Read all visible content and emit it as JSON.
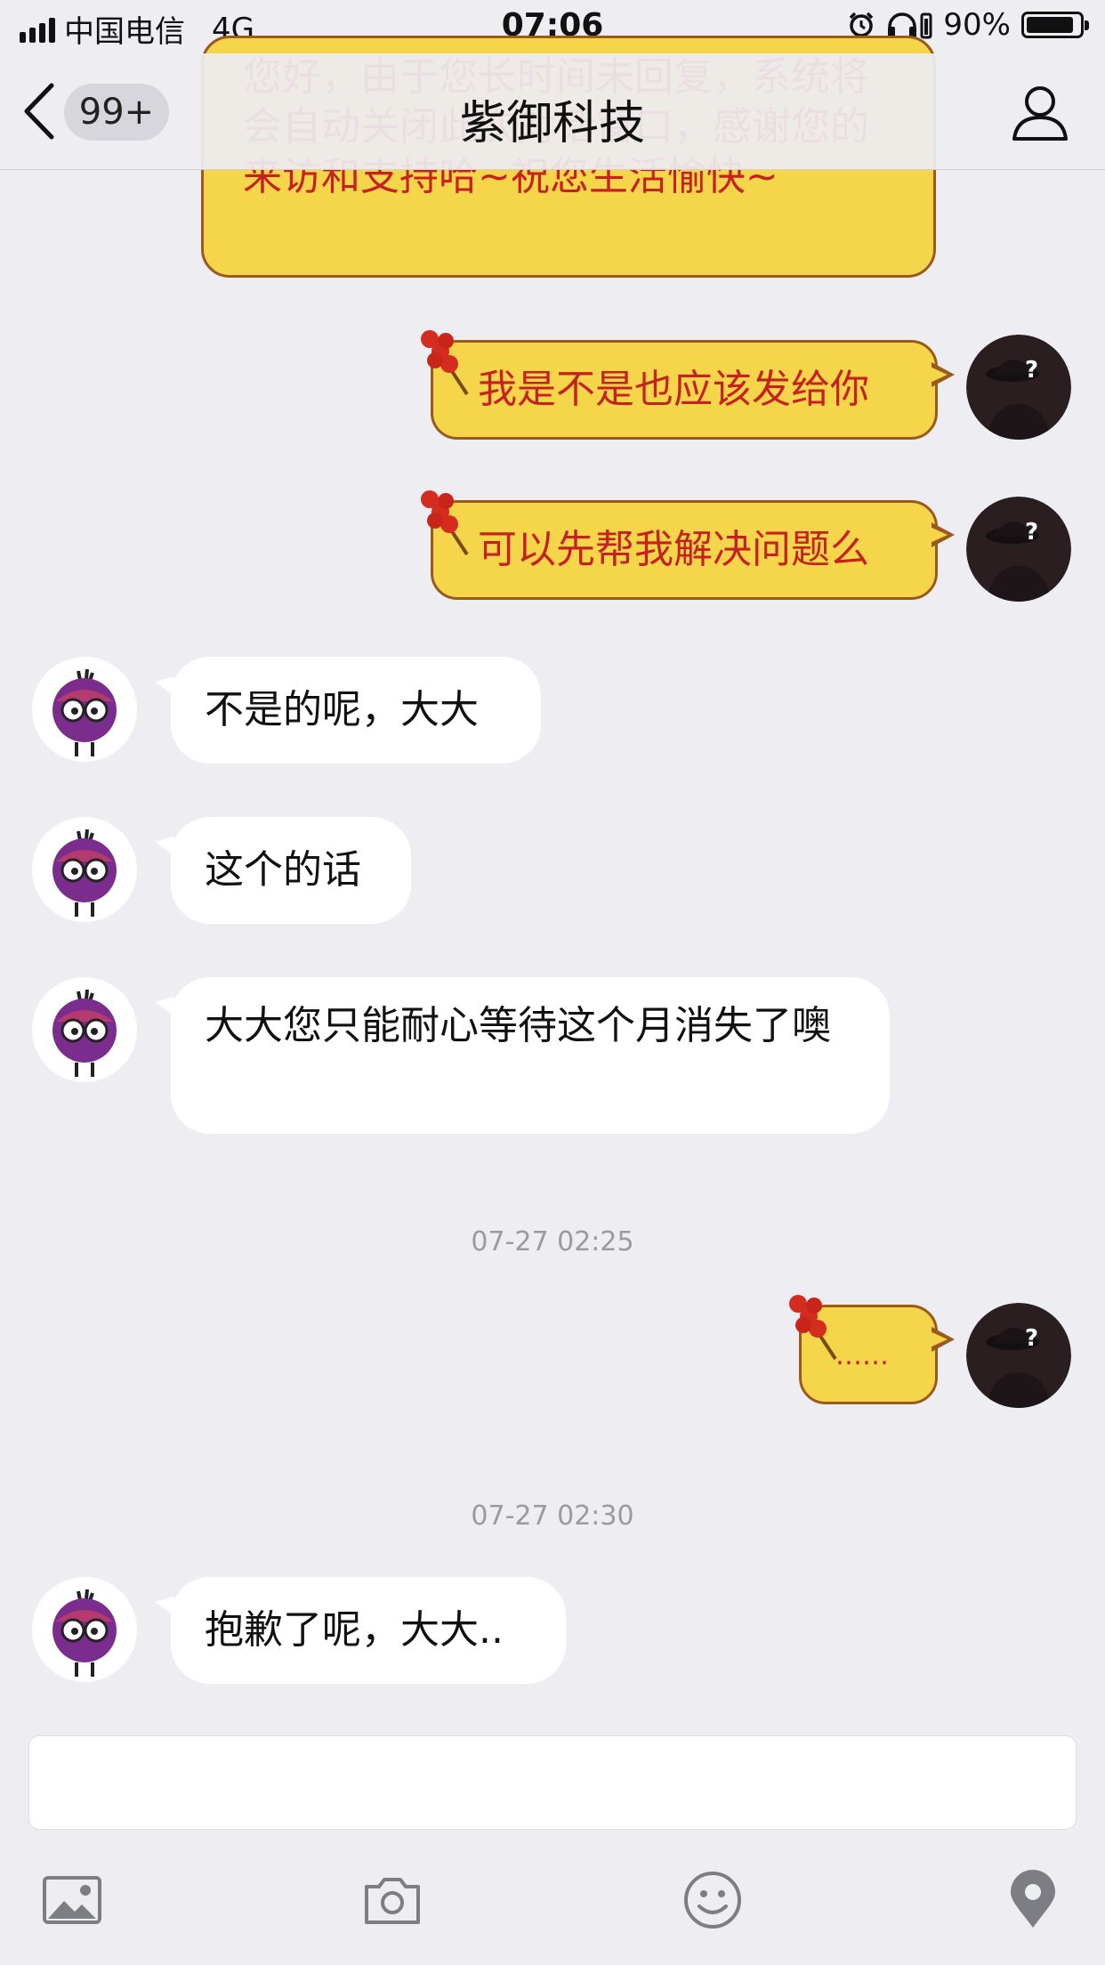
{
  "status": {
    "carrier": "中国电信",
    "network": "4G",
    "time": "07:06",
    "battery_text": "90%",
    "battery_level": 0.9
  },
  "nav": {
    "badge": "99+",
    "title": "紫御科技"
  },
  "messages": {
    "system_auto_reply": "您好，由于您长时间未回复，系统将会自动关闭此次对话窗口，感谢您的来访和支持哈~祝您生活愉快~",
    "sent_1": "我是不是也应该发给你",
    "sent_2": "可以先帮我解决问题么",
    "recv_1": "不是的呢，大大",
    "recv_2": "这个的话",
    "recv_3": "大大您只能耐心等待这个月消失了噢",
    "time_1": "07-27 02:25",
    "sent_3": "……",
    "time_2": "07-27 02:30",
    "recv_4": "抱歉了呢，大大.."
  },
  "icons": {
    "back": "chevron-left-icon",
    "profile": "person-icon",
    "toolbar": [
      "image-icon",
      "camera-icon",
      "emoji-icon",
      "location-icon"
    ]
  },
  "colors": {
    "background": "#ededf2",
    "sent_bubble": "#f5d54a",
    "sent_text": "#c5221f",
    "bot_avatar": "#7b2d8e"
  }
}
